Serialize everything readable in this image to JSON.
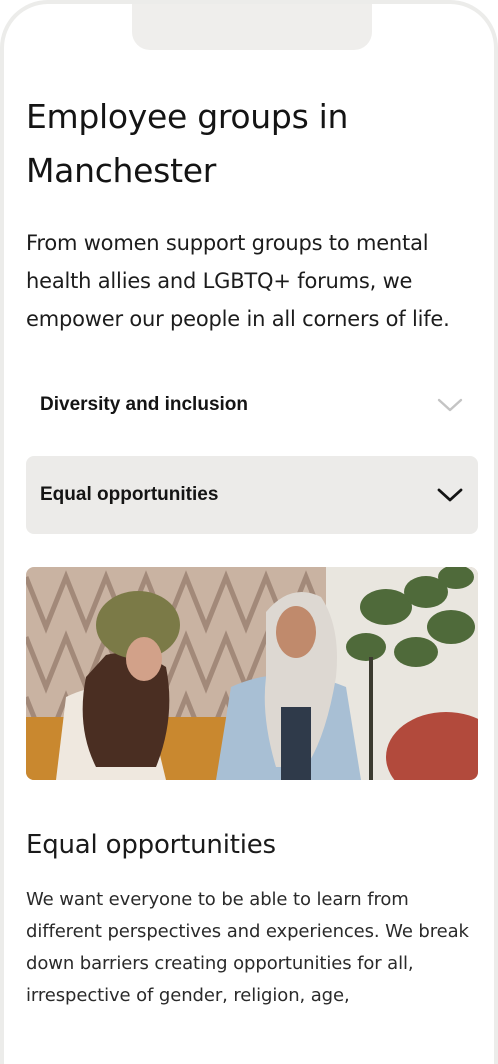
{
  "page": {
    "title": "Employee groups in Manchester",
    "intro": "From women support groups to mental health allies and LGBTQ+ forums, we empower our people in all corners of life."
  },
  "accordion": {
    "items": [
      {
        "label": "Diversity and inclusion",
        "expanded": false,
        "icon": "chevron-down-icon"
      },
      {
        "label": "Equal opportunities",
        "expanded": true,
        "icon": "chevron-down-icon"
      }
    ]
  },
  "section": {
    "title": "Equal opportunities",
    "body": "We want everyone to be able to learn from different perspectives and experiences. We break down barriers creating opportunities for all, irrespective of gender, religion, age,"
  },
  "colors": {
    "background": "#ffffff",
    "accordion_active_bg": "#ecebe9",
    "text": "#141414",
    "chevron_muted": "#c4c4c4"
  }
}
